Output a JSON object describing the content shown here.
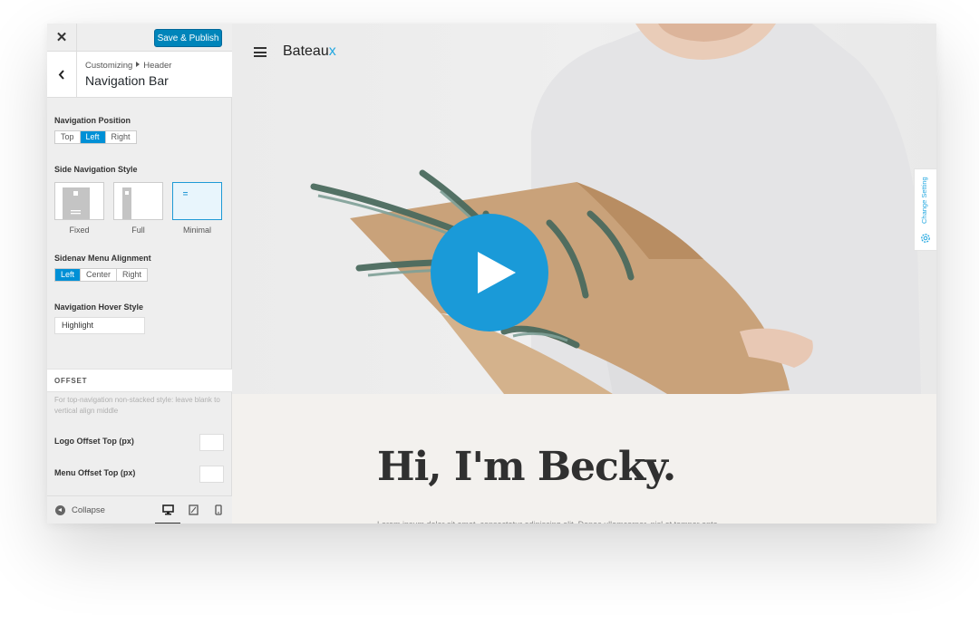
{
  "toolbar": {
    "close_icon": "close-icon",
    "publish_label": "Save & Publish"
  },
  "section": {
    "breadcrumb_root": "Customizing",
    "breadcrumb_parent": "Header",
    "title": "Navigation Bar"
  },
  "nav_position": {
    "label": "Navigation Position",
    "options": [
      "Top",
      "Left",
      "Right"
    ],
    "selected": "Left"
  },
  "side_nav_style": {
    "label": "Side Navigation Style",
    "options": [
      "Fixed",
      "Full",
      "Minimal"
    ],
    "selected": "Minimal"
  },
  "sidenav_alignment": {
    "label": "Sidenav Menu Alignment",
    "options": [
      "Left",
      "Center",
      "Right"
    ],
    "selected": "Left"
  },
  "hover_style": {
    "label": "Navigation Hover Style",
    "value": "Highlight"
  },
  "offset": {
    "heading": "OFFSET",
    "description": "For top-navigation non-stacked style: leave blank to vertical align middle",
    "logo_label": "Logo Offset Top (px)",
    "logo_value": "",
    "menu_label": "Menu Offset Top (px)",
    "menu_value": ""
  },
  "footer": {
    "collapse_label": "Collapse",
    "devices": [
      "desktop-icon",
      "tablet-icon",
      "mobile-icon"
    ],
    "active_device": "desktop"
  },
  "preview": {
    "brand": "Bateau",
    "brand_accent": "x",
    "change_setting": "Change Setting",
    "headline": "Hi, I'm Becky.",
    "body": "Lorem ipsum dolor sit amet, consectetur adipiscing elit. Donec ullamcorper, nisl et tempor ante.",
    "accent_color": "#1a9ad8"
  }
}
